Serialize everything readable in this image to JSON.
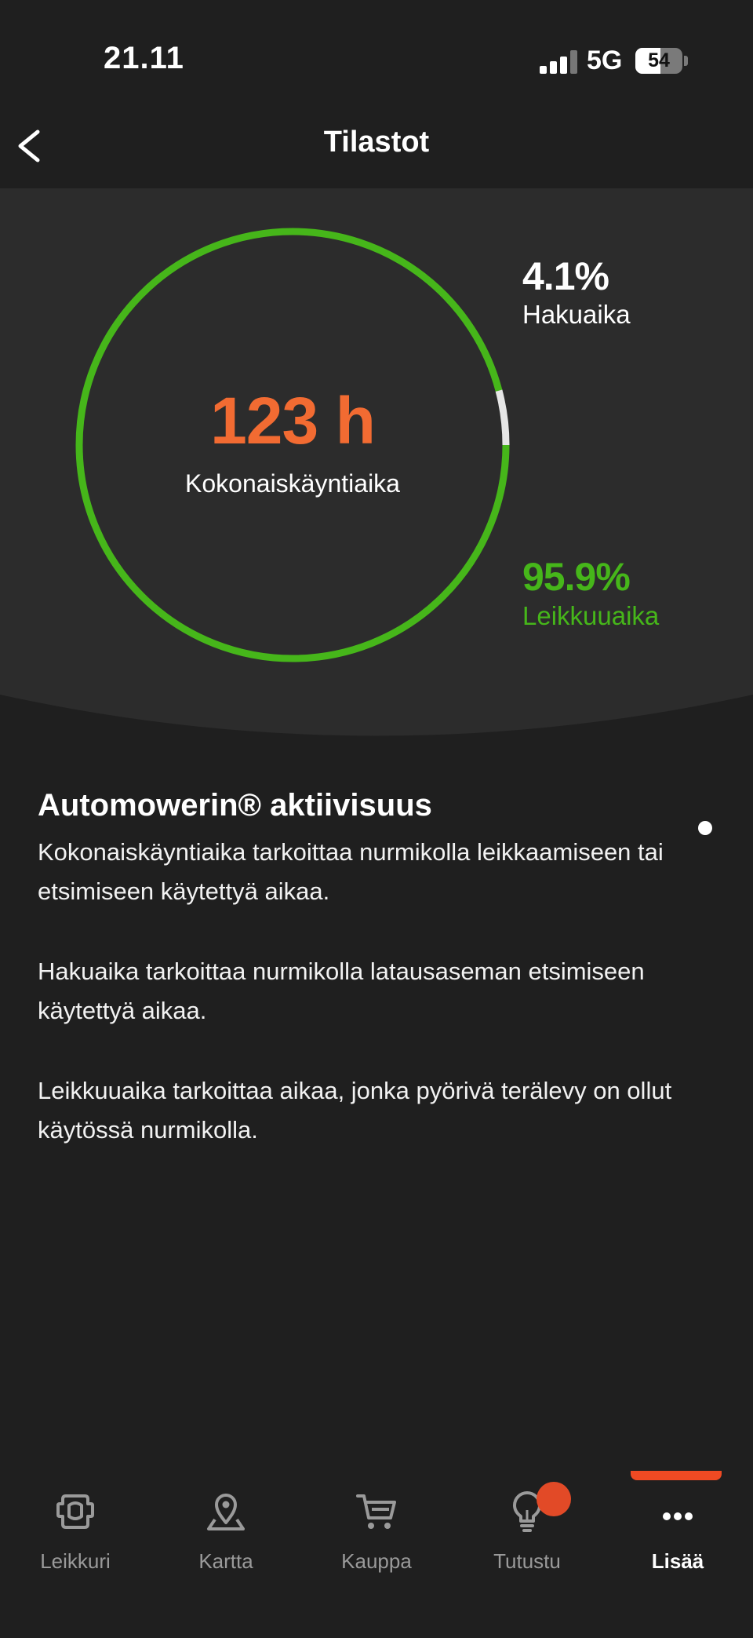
{
  "status_bar": {
    "time": "21.11",
    "network": "5G",
    "battery_level": "54"
  },
  "header": {
    "title": "Tilastot",
    "back_icon": "chevron-left-icon"
  },
  "stats": {
    "total_value": "123 h",
    "total_label": "Kokonaiskäyntiaika",
    "search_percent": "4.1%",
    "search_label": "Hakuaika",
    "cutting_percent": "95.9%",
    "cutting_label": "Leikkuuaika",
    "search_fraction": 0.041,
    "cutting_fraction": 0.959,
    "colors": {
      "cutting": "#46b61a",
      "search": "#e6e6e6",
      "total": "#f26b32"
    }
  },
  "info": {
    "title": "Automowerin® aktiivisuus",
    "paragraphs": [
      "Kokonaiskäyntiaika tarkoittaa nurmikolla leikkaamiseen tai etsimiseen käytettyä aikaa.",
      "Hakuaika tarkoittaa nurmikolla latausaseman etsimiseen käytettyä aikaa.",
      "Leikkuuaika tarkoittaa aikaa, jonka pyörivä terälevy on ollut käytössä nurmikolla."
    ]
  },
  "tabs": [
    {
      "label": "Leikkuri",
      "icon": "mower-icon",
      "active": false
    },
    {
      "label": "Kartta",
      "icon": "map-pin-icon",
      "active": false
    },
    {
      "label": "Kauppa",
      "icon": "cart-icon",
      "active": false
    },
    {
      "label": "Tutustu",
      "icon": "lightbulb-icon",
      "active": false,
      "badge": true
    },
    {
      "label": "Lisää",
      "icon": "more-icon",
      "active": true
    }
  ],
  "accent_color": "#ef4a23"
}
